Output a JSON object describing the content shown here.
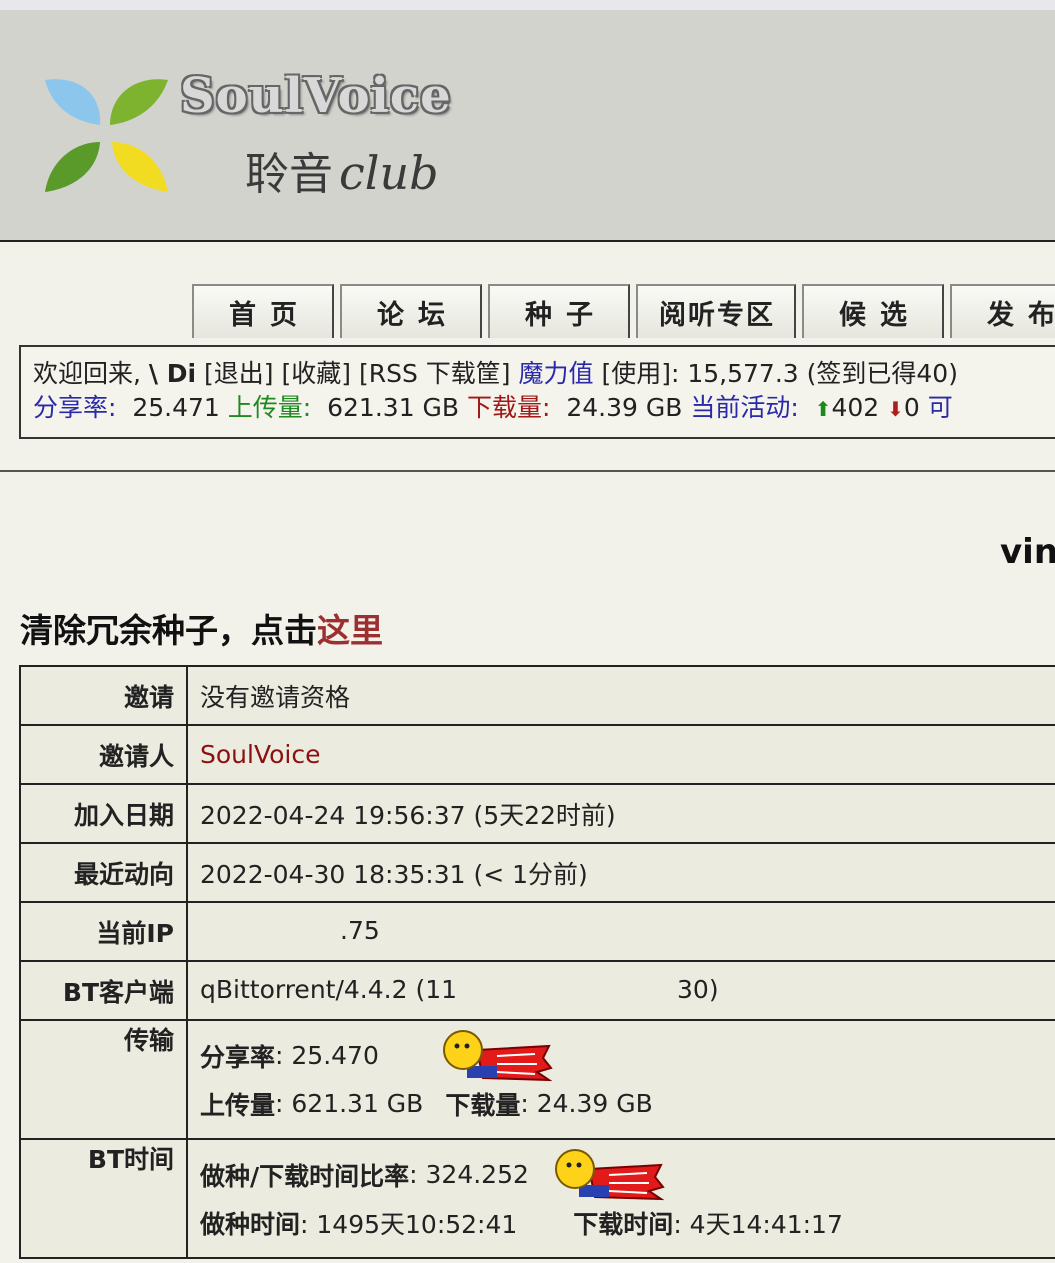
{
  "header": {
    "logo_title": "SoulVoice",
    "logo_subtitle": "聆音",
    "logo_club": "club"
  },
  "nav": {
    "tabs": [
      {
        "label": "首页"
      },
      {
        "label": "论坛"
      },
      {
        "label": "种子"
      },
      {
        "label": "阅听专区"
      },
      {
        "label": "候选"
      },
      {
        "label": "发布"
      }
    ]
  },
  "infobar": {
    "welcome": "欢迎回来,",
    "username": "\\ Di",
    "logout": "[退出]",
    "favorites": "[收藏]",
    "rss_basket": "[RSS 下载筐]",
    "bonus_label": "魔力值",
    "bonus_use": "[使用]",
    "bonus_value": ": 15,577.3",
    "signin": "(签到已得40)",
    "ratio_label": "分享率:",
    "ratio_value": "25.471",
    "upload_label": "上传量:",
    "upload_value": "621.31 GB",
    "download_label": "下载量:",
    "download_value": "24.39 GB",
    "active_label": "当前活动:",
    "seeding_count": "402",
    "leeching_count": "0",
    "trailing": "可"
  },
  "page": {
    "username_partial": "vin",
    "clean_text": "清除冗余种子，点击",
    "clean_link": "这里"
  },
  "details": {
    "invite_label": "邀请",
    "invite_value": "没有邀请资格",
    "inviter_label": "邀请人",
    "inviter_value": "SoulVoice",
    "joined_label": "加入日期",
    "joined_value": "2022-04-24 19:56:37 (5天22时前)",
    "last_action_label": "最近动向",
    "last_action_value": "2022-04-30 18:35:31 (< 1分前)",
    "ip_label": "当前IP",
    "ip_value": ".75",
    "client_label": "BT客户端",
    "client_value_start": "qBittorrent/4.4.2 (11",
    "client_value_end": "30)",
    "transfer_label": "传输",
    "ratio_label": "分享率",
    "ratio_value": ": 25.470",
    "uploaded_label": "上传量",
    "uploaded_value": ": 621.31 GB",
    "downloaded_label": "下载量",
    "downloaded_value": ": 24.39 GB",
    "bttime_label": "BT时间",
    "seed_ratio_label": "做种/下载时间比率",
    "seed_ratio_value": ": 324.252",
    "seed_time_label": "做种时间",
    "seed_time_value": ": 1495天10:52:41",
    "leech_time_label": "下载时间",
    "leech_time_value": ": 4天14:41:17"
  },
  "colors": {
    "header_bg": "#d3d3cd",
    "page_bg": "#f2f1ea",
    "table_bg": "#ecebdf",
    "link_blue": "#2a2aa8",
    "upload_green": "#1f8a1f",
    "download_red": "#a01818",
    "inviter_red": "#8c1010"
  }
}
